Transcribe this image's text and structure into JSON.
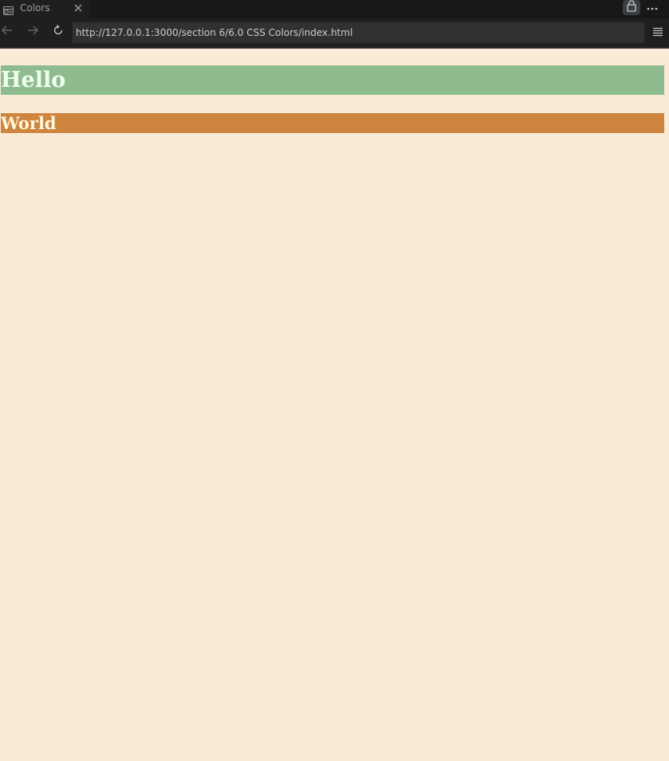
{
  "browser": {
    "tab": {
      "title": "Colors",
      "icon": "preview-page-icon"
    },
    "url": "http://127.0.0.1:3000/section 6/6.0 CSS Colors/index.html",
    "toolbar": {
      "back_icon": "arrow-left-icon",
      "forward_icon": "arrow-right-icon",
      "reload_icon": "reload-icon",
      "menu_icon": "hamburger-menu-icon",
      "lock_icon": "lock-icon",
      "more_icon": "ellipsis-icon",
      "close_icon": "close-icon"
    },
    "colors": {
      "chrome_dark": "#181818",
      "toolbar": "#1f1f1f",
      "url_field": "#313131"
    }
  },
  "page": {
    "background": "#faebd7",
    "heading1": {
      "text": "Hello",
      "background": "#8fbc8f",
      "color": "#f0fff0"
    },
    "heading2": {
      "text": "World",
      "background": "#cd853f",
      "color": "#fff8dc"
    }
  }
}
